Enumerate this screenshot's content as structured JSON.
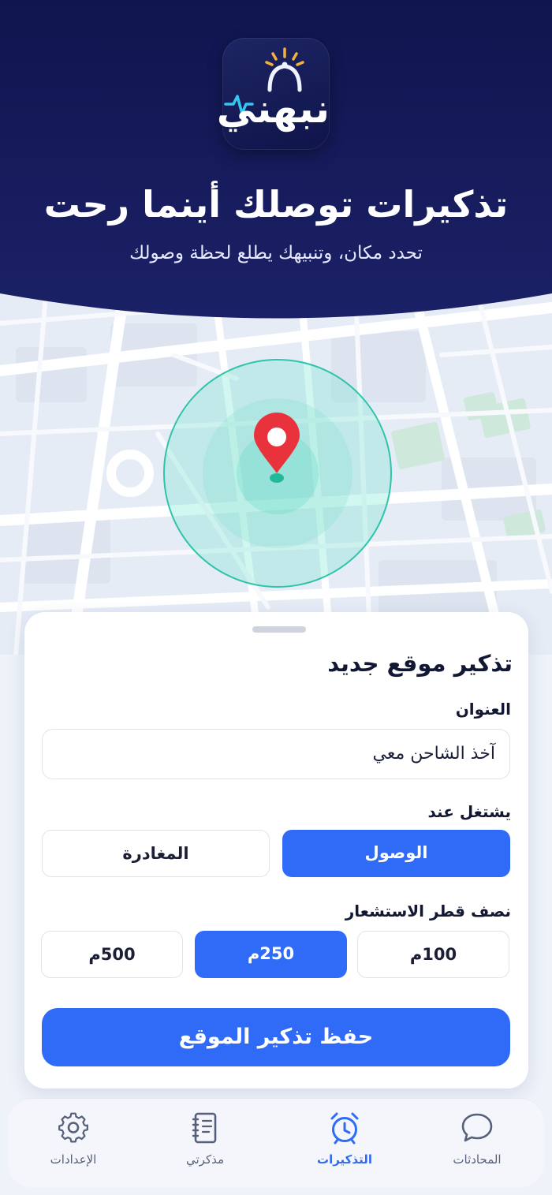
{
  "app": {
    "logo_text": "نبهني"
  },
  "hero": {
    "title": "تذكيرات توصلك أينما رحت",
    "subtitle": "تحدد مكان، وتنبيهك يطلع لحظة وصولك"
  },
  "form": {
    "title": "تذكير موقع جديد",
    "title_label": "العنوان",
    "title_value": "آخذ الشاحن معي",
    "trigger_label": "يشتغل عند",
    "trigger_options": [
      {
        "label": "الوصول",
        "selected": true
      },
      {
        "label": "المغادرة",
        "selected": false
      }
    ],
    "radius_label": "نصف قطر الاستشعار",
    "radius_options": [
      {
        "label": "100م",
        "selected": false
      },
      {
        "label": "250م",
        "selected": true
      },
      {
        "label": "500م",
        "selected": false
      }
    ],
    "save_label": "حفظ تذكير الموقع"
  },
  "nav": {
    "items": [
      {
        "label": "المحادثات",
        "icon": "chat-icon",
        "active": false
      },
      {
        "label": "التذكيرات",
        "icon": "alarm-clock-icon",
        "active": true
      },
      {
        "label": "مذكرتي",
        "icon": "notebook-icon",
        "active": false
      },
      {
        "label": "الإعدادات",
        "icon": "gear-icon",
        "active": false
      }
    ]
  },
  "colors": {
    "header_navy": "#141a5e",
    "accent_blue": "#2f6bf6",
    "geofence_teal": "#3fd6be",
    "pin_red": "#e8333c"
  }
}
